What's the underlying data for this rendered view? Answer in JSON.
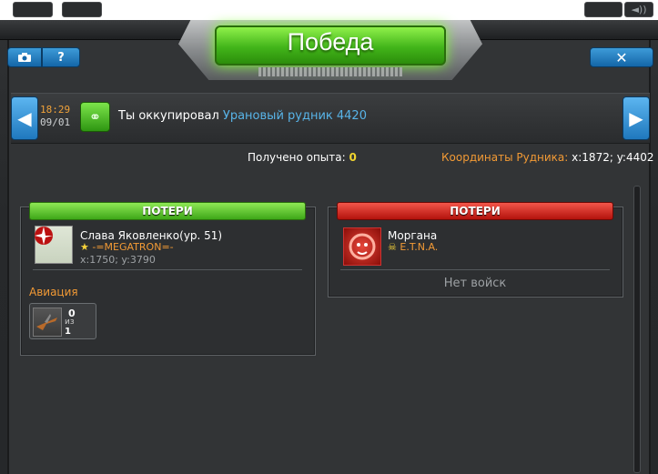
{
  "title": "Победа",
  "icons": {
    "help": "?",
    "close": "✕",
    "prev": "◀",
    "next": "▶"
  },
  "report": {
    "time": "18:29",
    "date": "09/01",
    "message": "Ты оккупировал",
    "target": "Урановый рудник 4420"
  },
  "stats": {
    "exp_label": "Получено опыта:",
    "exp_value": "0",
    "coords_label": "Координаты Рудника:",
    "coords_value": "x:1872; y:4402"
  },
  "attacker": {
    "losses_label": "ПОТЕРИ",
    "name": "Слава Яковленко(ур. 51)",
    "clan": "-=MEGATRON=-",
    "coords": "x:1750; y:3790",
    "category": "Авиация",
    "unit": {
      "lost": "0",
      "of_label": "из",
      "total": "1"
    }
  },
  "defender": {
    "losses_label": "ПОТЕРИ",
    "name": "Моргана",
    "clan": "E.T.N.A.",
    "no_troops": "Нет войск"
  },
  "colors": {
    "victory_green": "#42b51a",
    "loss_red": "#b3120c",
    "accent_orange": "#f29a35",
    "link_blue": "#58b4e8"
  }
}
